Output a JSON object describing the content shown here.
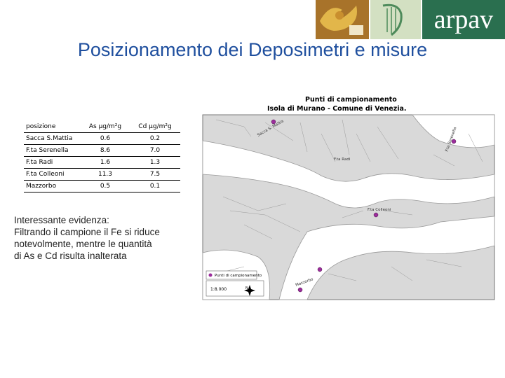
{
  "header": {
    "title": "Posizionamento dei Deposimetri e misure",
    "brand": "arpav"
  },
  "table": {
    "headers": [
      "posizione",
      "As µg/m²g",
      "Cd µg/m²g"
    ],
    "rows": [
      [
        "Sacca S.Mattia",
        "0.6",
        "0.2"
      ],
      [
        "F.ta Serenella",
        "8.6",
        "7.0"
      ],
      [
        "F.ta Radi",
        "1.6",
        "1.3"
      ],
      [
        "F.ta Colleoni",
        "11.3",
        "7.5"
      ],
      [
        "Mazzorbo",
        "0.5",
        "0.1"
      ]
    ]
  },
  "note": {
    "lines": [
      "Interessante evidenza:",
      "Filtrando il campione il Fe si riduce",
      "notevolmente, mentre le quantità",
      "di As e Cd risulta inalterata"
    ]
  },
  "map": {
    "title_line1": "Punti di campionamento",
    "title_line2": "Isola di Murano - Comune di Venezia.",
    "legend_label": "Punti di campionamento",
    "scale": "1:8.000",
    "compass_n": "N",
    "site_labels": [
      "Sacca S. Mattia",
      "F.ta Serenella",
      "F.ta Radi",
      "F.ta Colleoni",
      "Mazzorbo"
    ],
    "site_color": "#9b2d9b",
    "water_color": "#ffffff",
    "land_color": "#d9d9d9"
  },
  "colors": {
    "title": "#1f4f9e",
    "brand_bg": "#2a6f4f"
  }
}
